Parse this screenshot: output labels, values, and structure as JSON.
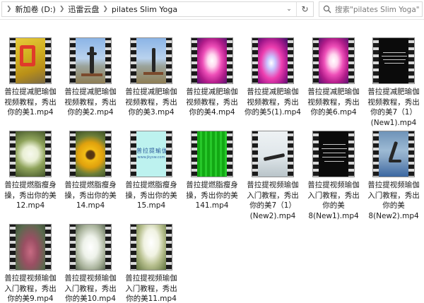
{
  "address_bar": {
    "crumbs": [
      "新加卷 (D:)",
      "迅雷云盘",
      "pilates Slim Yoga"
    ]
  },
  "search": {
    "placeholder": "搜索\"pilates Slim Yoga\""
  },
  "files": [
    {
      "line1": "普拉提减肥瑜伽",
      "line2": "视频教程，秀出",
      "line3": "你的美1.mp4",
      "line4": ""
    },
    {
      "line1": "普拉提减肥瑜伽",
      "line2": "视频教程，秀出",
      "line3": "你的美2.mp4",
      "line4": ""
    },
    {
      "line1": "普拉提减肥瑜伽",
      "line2": "视频教程，秀出",
      "line3": "你的美3.mp4",
      "line4": ""
    },
    {
      "line1": "普拉提减肥瑜伽",
      "line2": "视频教程，秀出",
      "line3": "你的美4.mp4",
      "line4": ""
    },
    {
      "line1": "普拉提减肥瑜伽",
      "line2": "视频教程，秀出",
      "line3": "你的美5(1).mp4",
      "line4": ""
    },
    {
      "line1": "普拉提减肥瑜伽",
      "line2": "视频教程，秀出",
      "line3": "你的美6.mp4",
      "line4": ""
    },
    {
      "line1": "普拉提减肥瑜伽",
      "line2": "视频教程，秀出",
      "line3": "你的美7（1）",
      "line4": "(New1).mp4"
    },
    {
      "line1": "普拉提燃脂瘦身",
      "line2": "操，秀出你的美",
      "line3": "12.mp4",
      "line4": ""
    },
    {
      "line1": "普拉提燃脂瘦身",
      "line2": "操，秀出你的美",
      "line3": "14.mp4",
      "line4": ""
    },
    {
      "line1": "普拉提燃脂瘦身",
      "line2": "操，秀出你的美",
      "line3": "15.mp4",
      "line4": ""
    },
    {
      "line1": "普拉提燃脂瘦身",
      "line2": "操，秀出你的美",
      "line3": "141.mp4",
      "line4": ""
    },
    {
      "line1": "普拉提视频瑜伽",
      "line2": "入门教程，秀出",
      "line3": "你的美7（1）",
      "line4": "(New2).mp4"
    },
    {
      "line1": "普拉提视频瑜伽",
      "line2": "入门教程，秀出",
      "line3": "你的美",
      "line4": "8(New1).mp4"
    },
    {
      "line1": "普拉提视频瑜伽",
      "line2": "入门教程，秀出",
      "line3": "你的美",
      "line4": "8(New2).mp4"
    },
    {
      "line1": "普拉提视频瑜伽",
      "line2": "入门教程，秀出",
      "line3": "你的美9.mp4",
      "line4": ""
    },
    {
      "line1": "普拉提视频瑜伽",
      "line2": "入门教程，秀出",
      "line3": "你的美10.mp4",
      "line4": ""
    },
    {
      "line1": "普拉提视频瑜伽",
      "line2": "入门教程，秀出",
      "line3": "你的美11.mp4",
      "line4": ""
    }
  ],
  "thumb_text": {
    "cyan_frame": "普拉提瑜伽",
    "cyan_frame_sub": "www.jkysw.com"
  },
  "icons": {
    "addr_dropdown": "chevron-down-icon",
    "refresh": "refresh-icon",
    "search": "search-icon",
    "thumbnail": "video-thumbnail"
  }
}
